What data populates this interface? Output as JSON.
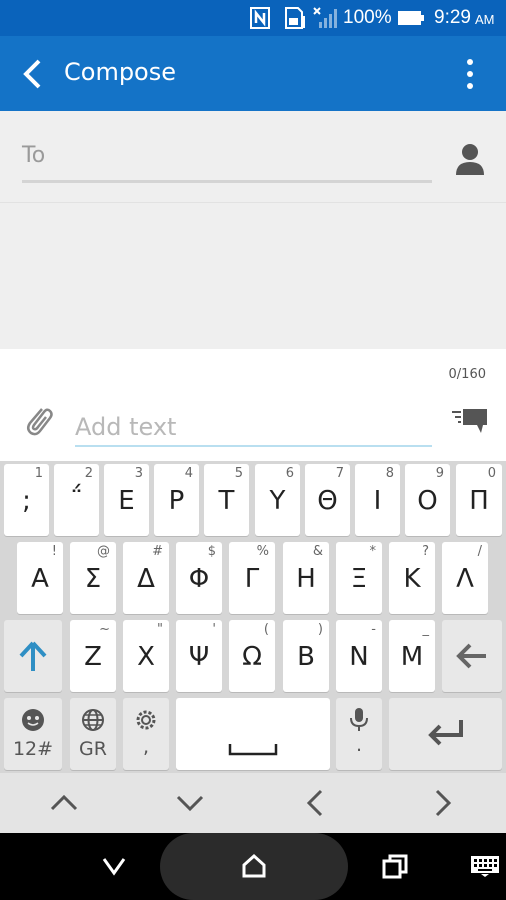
{
  "status_bar": {
    "battery": "100%",
    "time": "9:29",
    "ampm": "AM"
  },
  "app_bar": {
    "title": "Compose"
  },
  "recipient": {
    "placeholder": "To"
  },
  "compose": {
    "counter": "0/160",
    "placeholder": "Add text"
  },
  "keyboard": {
    "row1": [
      {
        "main": ";",
        "hint": "1"
      },
      {
        "main": "΅",
        "hint": "2"
      },
      {
        "main": "Ε",
        "hint": "3"
      },
      {
        "main": "Ρ",
        "hint": "4"
      },
      {
        "main": "Τ",
        "hint": "5"
      },
      {
        "main": "Υ",
        "hint": "6"
      },
      {
        "main": "Θ",
        "hint": "7"
      },
      {
        "main": "Ι",
        "hint": "8"
      },
      {
        "main": "Ο",
        "hint": "9"
      },
      {
        "main": "Π",
        "hint": "0"
      }
    ],
    "row2": [
      {
        "main": "Α",
        "hint": "!"
      },
      {
        "main": "Σ",
        "hint": "@"
      },
      {
        "main": "Δ",
        "hint": "#"
      },
      {
        "main": "Φ",
        "hint": "$"
      },
      {
        "main": "Γ",
        "hint": "%"
      },
      {
        "main": "Η",
        "hint": "&"
      },
      {
        "main": "Ξ",
        "hint": "*"
      },
      {
        "main": "Κ",
        "hint": "?"
      },
      {
        "main": "Λ",
        "hint": "/"
      }
    ],
    "row3": [
      {
        "main": "Ζ",
        "hint": "~"
      },
      {
        "main": "Χ",
        "hint": "\""
      },
      {
        "main": "Ψ",
        "hint": "'"
      },
      {
        "main": "Ω",
        "hint": "("
      },
      {
        "main": "Β",
        "hint": ")"
      },
      {
        "main": "Ν",
        "hint": "-"
      },
      {
        "main": "Μ",
        "hint": "_"
      }
    ],
    "row4": {
      "symbols_label": "12#",
      "language_label": "GR",
      "settings_sub": ",",
      "mic_sub": "."
    }
  },
  "icons": {
    "back": "chevron-left-icon",
    "more": "more-vertical-icon",
    "contact": "person-icon",
    "attach": "paperclip-icon",
    "send": "sms-send-icon",
    "shift": "shift-arrow-icon",
    "backspace": "backspace-arrow-icon",
    "emoji": "smiley-icon",
    "globe": "globe-icon",
    "settings": "gear-icon",
    "mic": "microphone-icon",
    "enter": "enter-icon"
  },
  "colors": {
    "status_bar": "#0a63bb",
    "app_bar": "#1473c7",
    "accent_shift": "#2f8fc4",
    "keyboard_bg": "#d6d6d6"
  }
}
